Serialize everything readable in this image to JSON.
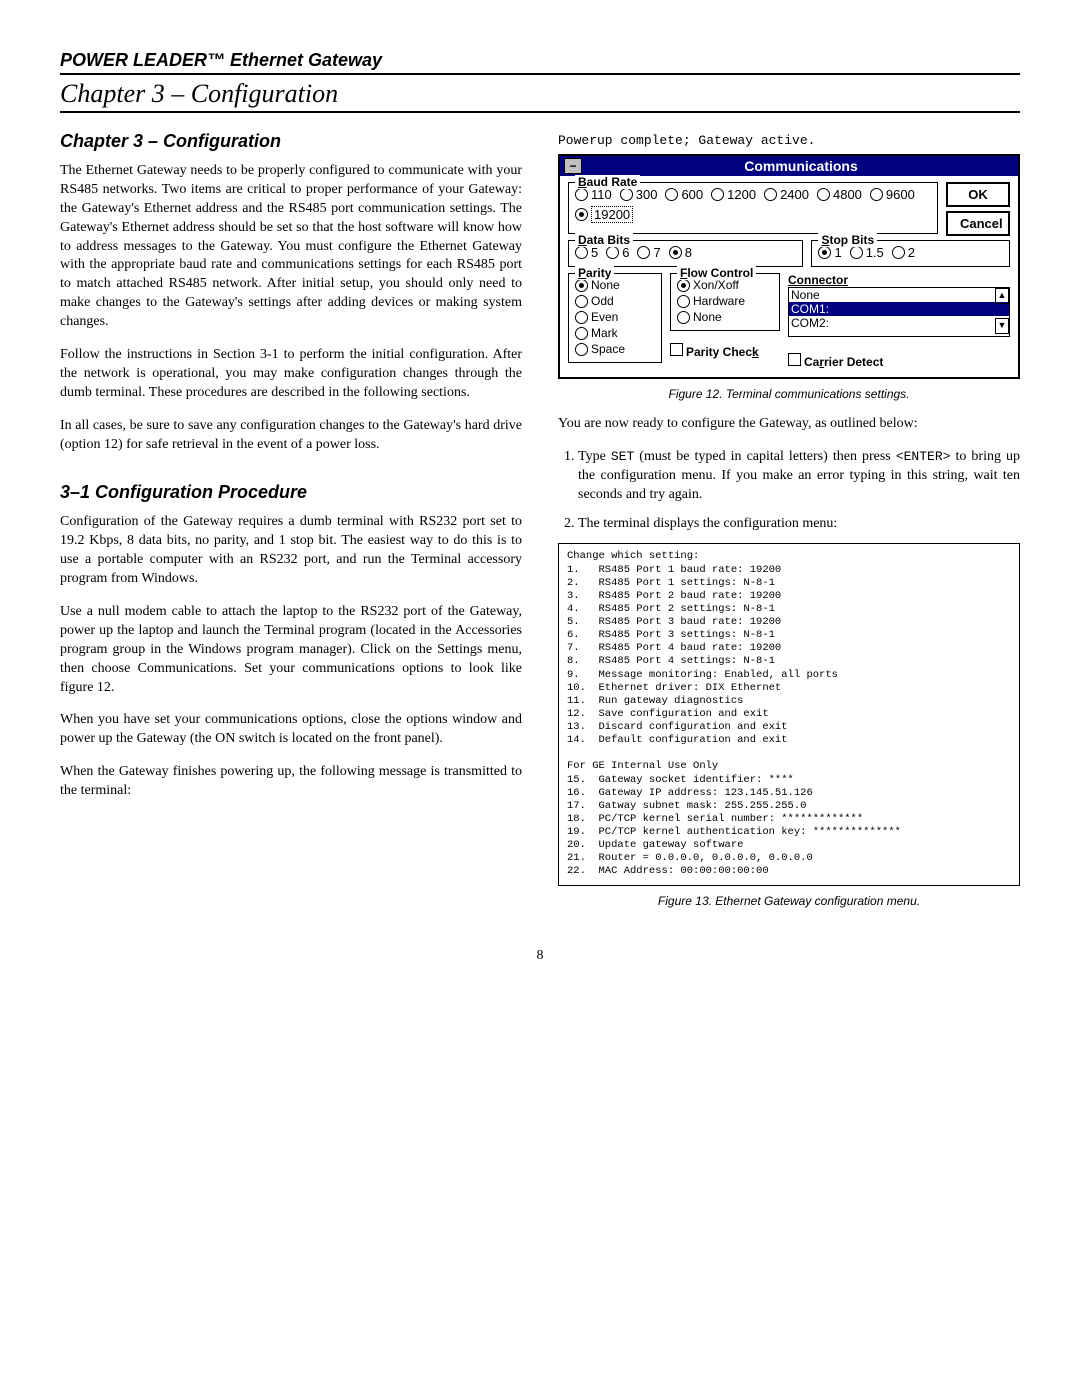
{
  "header": {
    "title_prefix": "POWER LEADER",
    "title_suffix": " Ethernet Gateway",
    "tm": "™",
    "subtitle": "Chapter 3 – Configuration"
  },
  "left": {
    "section_head": "Chapter 3 – Configuration",
    "p1": "The Ethernet Gateway needs to be properly configured to communicate with your RS485 networks. Two items are critical to proper performance of your Gateway: the Gateway's Ethernet address and the RS485 port communication settings. The Gateway's Ethernet address should be set so that the host software will know how to address messages to the Gateway. You must configure the Ethernet Gateway with the appropriate baud rate and communications settings for each RS485 port to match attached RS485 network. After initial setup, you should only need to make changes to the Gateway's settings after adding devices or making system changes.",
    "p2": "Follow the instructions in Section 3-1 to perform the initial configuration. After the network is operational, you may make configuration changes through the dumb terminal. These procedures are described in the following sections.",
    "p3": "In all cases, be sure to save any configuration changes to the Gateway's hard drive (option 12) for safe retrieval in the event of a power loss.",
    "subhead": "3–1 Configuration Procedure",
    "p4": "Configuration of the Gateway requires a dumb terminal with RS232 port set to 19.2 Kbps, 8 data bits, no parity, and 1 stop bit. The easiest way to do this is to use a portable computer with an RS232 port, and run the Terminal accessory program from Windows.",
    "p5": "Use a null modem cable to attach the laptop to the RS232 port of the Gateway, power up the laptop and launch the Terminal program (located in the Accessories program group in the Windows program manager). Click on the Settings menu, then choose Communications. Set your communications options to look like figure 12.",
    "p6": "When you have set your communications options, close the options window and power up the Gateway (the ON switch is located on the front panel).",
    "p7": "When the Gateway finishes powering up, the following message is transmitted to the terminal:"
  },
  "right": {
    "powerup_msg": "Powerup complete; Gateway active.",
    "dialog": {
      "title": "Communications",
      "ok": "OK",
      "cancel": "Cancel",
      "baud_label": "Baud Rate",
      "baud_opts": [
        "110",
        "300",
        "600",
        "1200",
        "2400",
        "4800",
        "9600",
        "19200"
      ],
      "baud_selected": "19200",
      "data_label": "Data Bits",
      "data_opts": [
        "5",
        "6",
        "7",
        "8"
      ],
      "data_selected": "8",
      "stop_label": "Stop Bits",
      "stop_opts": [
        "1",
        "1.5",
        "2"
      ],
      "stop_selected": "1",
      "parity_label": "Parity",
      "parity_opts": [
        "None",
        "Odd",
        "Even",
        "Mark",
        "Space"
      ],
      "parity_selected": "None",
      "flow_label": "Flow Control",
      "flow_opts": [
        "Xon/Xoff",
        "Hardware",
        "None"
      ],
      "flow_selected": "Xon/Xoff",
      "connector_label": "Connector",
      "connector_opts": [
        "None",
        "COM1:",
        "COM2:"
      ],
      "connector_selected": "COM1:",
      "parity_check": "Parity Check",
      "carrier_detect": "Carrier Detect"
    },
    "fig12": "Figure 12. Terminal communications settings.",
    "p_after": "You are now ready to configure the Gateway, as outlined below:",
    "step1a": "Type ",
    "step1_set": "SET",
    "step1b": " (must be typed in capital letters) then press ",
    "step1_enter": "<ENTER>",
    "step1c": " to bring up the configuration menu. If you make an error typing in this string, wait ten seconds and try again.",
    "step2": "The terminal displays the configuration menu:",
    "menu_text": "Change which setting:\n1.   RS485 Port 1 baud rate: 19200\n2.   RS485 Port 1 settings: N-8-1\n3.   RS485 Port 2 baud rate: 19200\n4.   RS485 Port 2 settings: N-8-1\n5.   RS485 Port 3 baud rate: 19200\n6.   RS485 Port 3 settings: N-8-1\n7.   RS485 Port 4 baud rate: 19200\n8.   RS485 Port 4 settings: N-8-1\n9.   Message monitoring: Enabled, all ports\n10.  Ethernet driver: DIX Ethernet\n11.  Run gateway diagnostics\n12.  Save configuration and exit\n13.  Discard configuration and exit\n14.  Default configuration and exit\n\nFor GE Internal Use Only\n15.  Gateway socket identifier: ****\n16.  Gateway IP address: 123.145.51.126\n17.  Gatway subnet mask: 255.255.255.0\n18.  PC/TCP kernel serial number: *************\n19.  PC/TCP kernel authentication key: **************\n20.  Update gateway software\n21.  Router = 0.0.0.0, 0.0.0.0, 0.0.0.0\n22.  MAC Address: 00:00:00:00:00",
    "fig13": "Figure 13. Ethernet Gateway configuration menu."
  },
  "page_num": "8"
}
